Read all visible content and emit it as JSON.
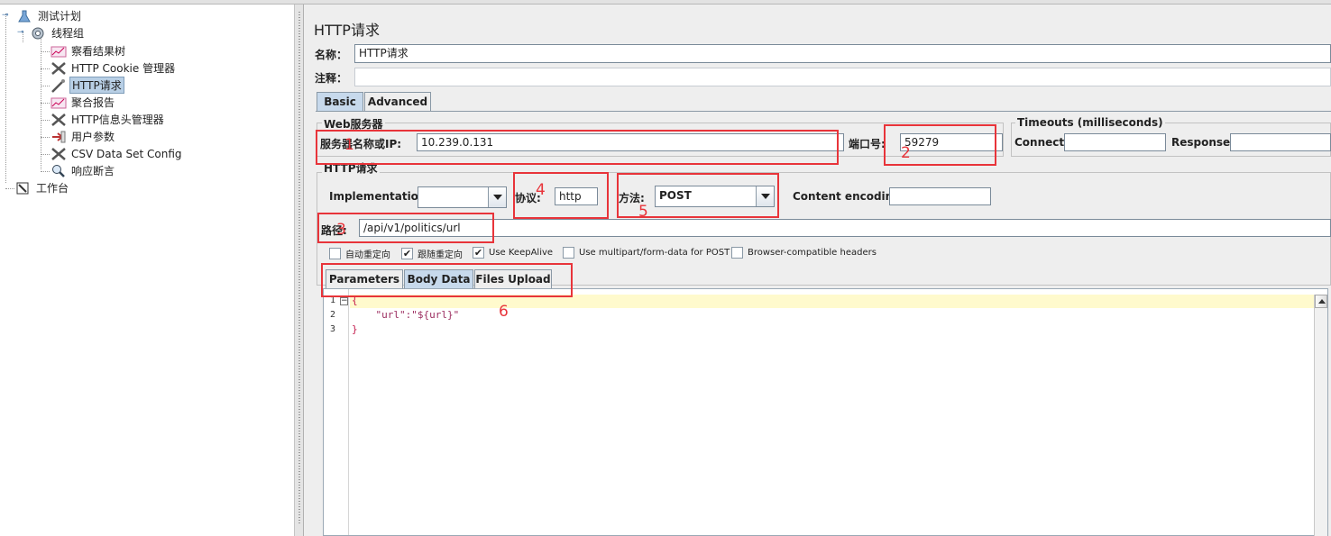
{
  "tree": {
    "items": [
      {
        "label": "测试计划",
        "icon": "test-plan-icon"
      },
      {
        "label": "线程组",
        "icon": "thread-group-gear-icon"
      },
      {
        "label": "察看结果树",
        "icon": "view-results-tree-icon"
      },
      {
        "label": "HTTP Cookie 管理器",
        "icon": "cookie-manager-tools-icon"
      },
      {
        "label": "HTTP请求",
        "icon": "http-sampler-pipette-icon"
      },
      {
        "label": "聚合报告",
        "icon": "aggregate-report-icon"
      },
      {
        "label": "HTTP信息头管理器",
        "icon": "header-manager-tools-icon"
      },
      {
        "label": "用户参数",
        "icon": "user-parameters-icon"
      },
      {
        "label": "CSV Data Set Config",
        "icon": "csv-config-tools-icon"
      },
      {
        "label": "响应断言",
        "icon": "response-assertion-magnifier-icon"
      },
      {
        "label": "工作台",
        "icon": "workbench-icon"
      }
    ]
  },
  "panel": {
    "title": "HTTP请求",
    "name_label": "名称：",
    "name_value": "HTTP请求",
    "comment_label": "注释：",
    "tabs": [
      "Basic",
      "Advanced"
    ],
    "web_server": {
      "legend": "Web服务器",
      "server_label": "服务器名称或IP:",
      "server_value": "10.239.0.131",
      "port_label": "端口号:",
      "port_value": "59279"
    },
    "timeouts": {
      "legend": "Timeouts (milliseconds)",
      "connect_label": "Connect:",
      "response_label": "Response:"
    },
    "http_request": {
      "legend": "HTTP请求",
      "implementation_label": "Implementation:",
      "implementation_value": "",
      "protocol_label": "协议:",
      "protocol_value": "http",
      "method_label": "方法:",
      "method_value": "POST",
      "encoding_label": "Content encoding:",
      "path_label": "路径:",
      "path_value": "/api/v1/politics/url"
    },
    "checkboxes": [
      {
        "label": "自动重定向",
        "checked": false
      },
      {
        "label": "跟随重定向",
        "checked": true
      },
      {
        "label": "Use KeepAlive",
        "checked": true
      },
      {
        "label": "Use multipart/form-data for POST",
        "checked": false
      },
      {
        "label": "Browser-compatible headers",
        "checked": false
      }
    ],
    "sub_tabs": [
      "Parameters",
      "Body Data",
      "Files Upload"
    ],
    "body": {
      "line_numbers": [
        "1",
        "2",
        "3"
      ],
      "lines": [
        "{",
        "    \"url\":\"${url}\"",
        "}"
      ]
    }
  },
  "annotations": {
    "labels": [
      "1",
      "2",
      "4",
      "5",
      "3",
      "6"
    ],
    "color": "#e8343a"
  },
  "colors": {
    "selection": "#b8cfe5",
    "active_tab": "#c7d9ec",
    "current_line": "#fffacd"
  }
}
